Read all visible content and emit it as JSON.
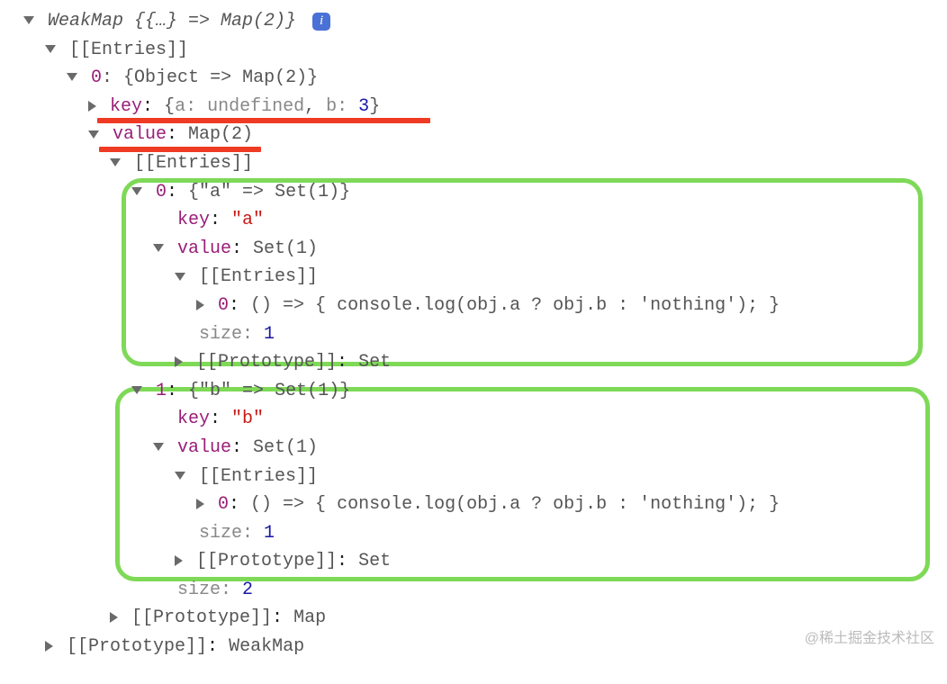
{
  "header": {
    "label": "WeakMap {{…} => Map(2)}",
    "info_icon": "i"
  },
  "entries_label": "[[Entries]]",
  "prototype_label": "[[Prototype]]",
  "size_label": "size",
  "entry0": {
    "index_label": "0",
    "summary": "{Object => Map(2)}",
    "key_label": "key",
    "key_open": "{",
    "key_a_name": "a",
    "key_a_value": "undefined",
    "key_sep": ", ",
    "key_b_name": "b",
    "key_b_value": "3",
    "key_close": "}",
    "value_label": "value",
    "value_summary": "Map(2)",
    "inner": {
      "a": {
        "index": "0",
        "summary": "{\"a\" => Set(1)}",
        "key_label": "key",
        "key_value": "\"a\"",
        "value_label": "value",
        "value_summary": "Set(1)",
        "set_entry_index": "0",
        "set_entry_body": "() => { console.log(obj.a ? obj.b : 'nothing'); }",
        "size": "1",
        "proto_value": "Set"
      },
      "b": {
        "index": "1",
        "summary": "{\"b\" => Set(1)}",
        "key_label": "key",
        "key_value": "\"b\"",
        "value_label": "value",
        "value_summary": "Set(1)",
        "set_entry_index": "0",
        "set_entry_body": "() => { console.log(obj.a ? obj.b : 'nothing'); }",
        "size": "1",
        "proto_value": "Set"
      },
      "size": "2",
      "proto_value": "Map"
    }
  },
  "outer_proto_value": "WeakMap",
  "watermark": "@稀土掘金技术社区"
}
